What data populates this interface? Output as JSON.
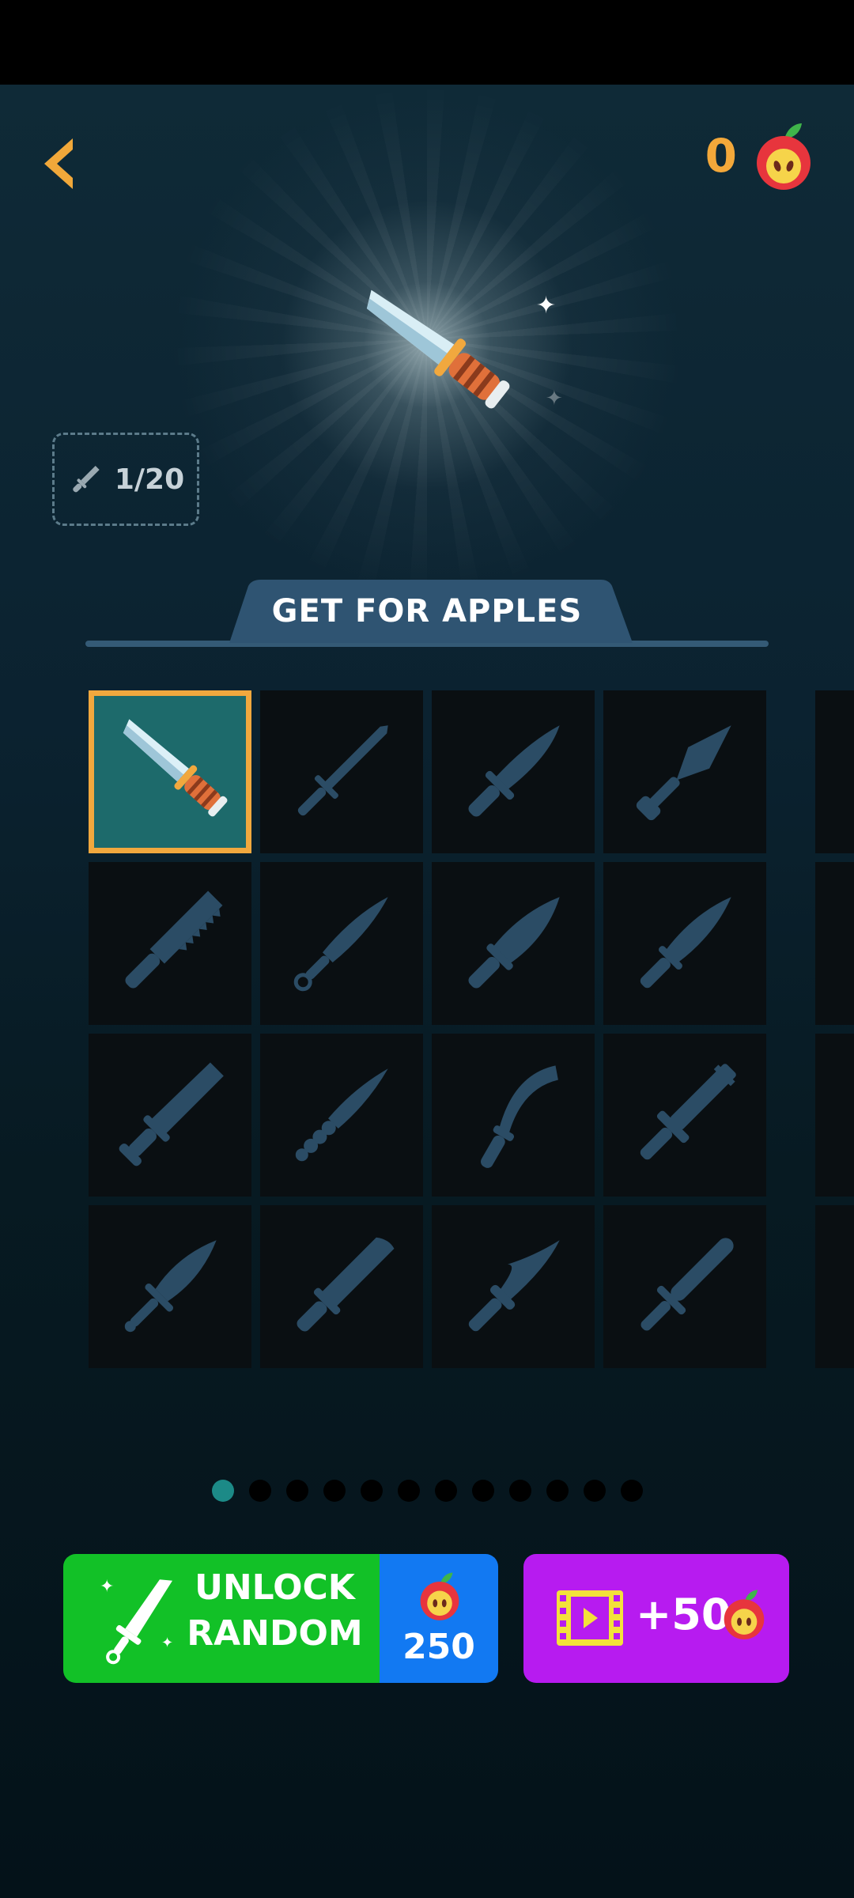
{
  "header": {
    "apples": "0"
  },
  "progress": {
    "text": "1/20",
    "icon": "knife-icon"
  },
  "banner": {
    "title": "GET FOR APPLES"
  },
  "grid": {
    "selected_index": 0,
    "rows": 4,
    "columns": 4
  },
  "pager": {
    "pages": 12,
    "active": 0
  },
  "buttons": {
    "unlock": {
      "line1": "UNLOCK",
      "line2": "RANDOM",
      "price": "250"
    },
    "video": {
      "label": "+50"
    }
  },
  "colors": {
    "accent_orange": "#f3a83a",
    "unlock_green": "#12c127",
    "unlock_blue": "#1279f2",
    "video_purple": "#b71bf0",
    "locked_silhouette": "#2b4c65"
  }
}
